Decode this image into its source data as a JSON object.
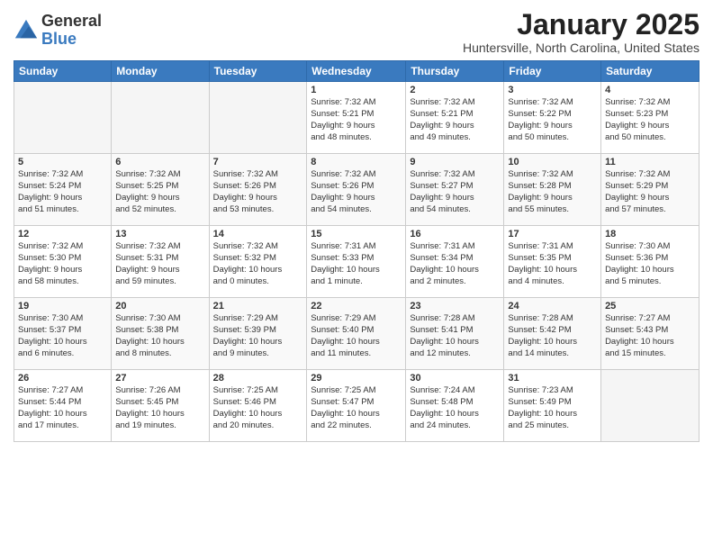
{
  "header": {
    "logo_general": "General",
    "logo_blue": "Blue",
    "month_title": "January 2025",
    "location": "Huntersville, North Carolina, United States"
  },
  "weekdays": [
    "Sunday",
    "Monday",
    "Tuesday",
    "Wednesday",
    "Thursday",
    "Friday",
    "Saturday"
  ],
  "weeks": [
    [
      {
        "day": "",
        "info": ""
      },
      {
        "day": "",
        "info": ""
      },
      {
        "day": "",
        "info": ""
      },
      {
        "day": "1",
        "info": "Sunrise: 7:32 AM\nSunset: 5:21 PM\nDaylight: 9 hours\nand 48 minutes."
      },
      {
        "day": "2",
        "info": "Sunrise: 7:32 AM\nSunset: 5:21 PM\nDaylight: 9 hours\nand 49 minutes."
      },
      {
        "day": "3",
        "info": "Sunrise: 7:32 AM\nSunset: 5:22 PM\nDaylight: 9 hours\nand 50 minutes."
      },
      {
        "day": "4",
        "info": "Sunrise: 7:32 AM\nSunset: 5:23 PM\nDaylight: 9 hours\nand 50 minutes."
      }
    ],
    [
      {
        "day": "5",
        "info": "Sunrise: 7:32 AM\nSunset: 5:24 PM\nDaylight: 9 hours\nand 51 minutes."
      },
      {
        "day": "6",
        "info": "Sunrise: 7:32 AM\nSunset: 5:25 PM\nDaylight: 9 hours\nand 52 minutes."
      },
      {
        "day": "7",
        "info": "Sunrise: 7:32 AM\nSunset: 5:26 PM\nDaylight: 9 hours\nand 53 minutes."
      },
      {
        "day": "8",
        "info": "Sunrise: 7:32 AM\nSunset: 5:26 PM\nDaylight: 9 hours\nand 54 minutes."
      },
      {
        "day": "9",
        "info": "Sunrise: 7:32 AM\nSunset: 5:27 PM\nDaylight: 9 hours\nand 54 minutes."
      },
      {
        "day": "10",
        "info": "Sunrise: 7:32 AM\nSunset: 5:28 PM\nDaylight: 9 hours\nand 55 minutes."
      },
      {
        "day": "11",
        "info": "Sunrise: 7:32 AM\nSunset: 5:29 PM\nDaylight: 9 hours\nand 57 minutes."
      }
    ],
    [
      {
        "day": "12",
        "info": "Sunrise: 7:32 AM\nSunset: 5:30 PM\nDaylight: 9 hours\nand 58 minutes."
      },
      {
        "day": "13",
        "info": "Sunrise: 7:32 AM\nSunset: 5:31 PM\nDaylight: 9 hours\nand 59 minutes."
      },
      {
        "day": "14",
        "info": "Sunrise: 7:32 AM\nSunset: 5:32 PM\nDaylight: 10 hours\nand 0 minutes."
      },
      {
        "day": "15",
        "info": "Sunrise: 7:31 AM\nSunset: 5:33 PM\nDaylight: 10 hours\nand 1 minute."
      },
      {
        "day": "16",
        "info": "Sunrise: 7:31 AM\nSunset: 5:34 PM\nDaylight: 10 hours\nand 2 minutes."
      },
      {
        "day": "17",
        "info": "Sunrise: 7:31 AM\nSunset: 5:35 PM\nDaylight: 10 hours\nand 4 minutes."
      },
      {
        "day": "18",
        "info": "Sunrise: 7:30 AM\nSunset: 5:36 PM\nDaylight: 10 hours\nand 5 minutes."
      }
    ],
    [
      {
        "day": "19",
        "info": "Sunrise: 7:30 AM\nSunset: 5:37 PM\nDaylight: 10 hours\nand 6 minutes."
      },
      {
        "day": "20",
        "info": "Sunrise: 7:30 AM\nSunset: 5:38 PM\nDaylight: 10 hours\nand 8 minutes."
      },
      {
        "day": "21",
        "info": "Sunrise: 7:29 AM\nSunset: 5:39 PM\nDaylight: 10 hours\nand 9 minutes."
      },
      {
        "day": "22",
        "info": "Sunrise: 7:29 AM\nSunset: 5:40 PM\nDaylight: 10 hours\nand 11 minutes."
      },
      {
        "day": "23",
        "info": "Sunrise: 7:28 AM\nSunset: 5:41 PM\nDaylight: 10 hours\nand 12 minutes."
      },
      {
        "day": "24",
        "info": "Sunrise: 7:28 AM\nSunset: 5:42 PM\nDaylight: 10 hours\nand 14 minutes."
      },
      {
        "day": "25",
        "info": "Sunrise: 7:27 AM\nSunset: 5:43 PM\nDaylight: 10 hours\nand 15 minutes."
      }
    ],
    [
      {
        "day": "26",
        "info": "Sunrise: 7:27 AM\nSunset: 5:44 PM\nDaylight: 10 hours\nand 17 minutes."
      },
      {
        "day": "27",
        "info": "Sunrise: 7:26 AM\nSunset: 5:45 PM\nDaylight: 10 hours\nand 19 minutes."
      },
      {
        "day": "28",
        "info": "Sunrise: 7:25 AM\nSunset: 5:46 PM\nDaylight: 10 hours\nand 20 minutes."
      },
      {
        "day": "29",
        "info": "Sunrise: 7:25 AM\nSunset: 5:47 PM\nDaylight: 10 hours\nand 22 minutes."
      },
      {
        "day": "30",
        "info": "Sunrise: 7:24 AM\nSunset: 5:48 PM\nDaylight: 10 hours\nand 24 minutes."
      },
      {
        "day": "31",
        "info": "Sunrise: 7:23 AM\nSunset: 5:49 PM\nDaylight: 10 hours\nand 25 minutes."
      },
      {
        "day": "",
        "info": ""
      }
    ]
  ]
}
